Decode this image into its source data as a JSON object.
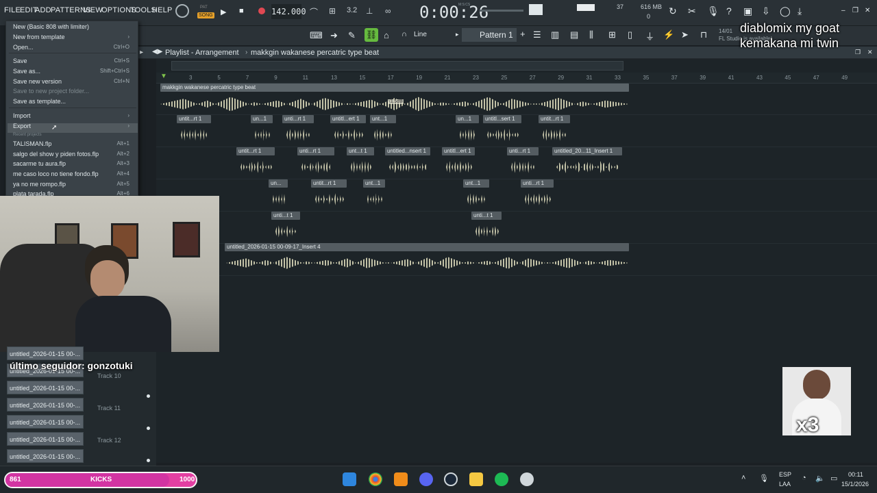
{
  "menubar": {
    "items": [
      "FILE",
      "EDIT",
      "ADD",
      "PATTERNS",
      "VIEW",
      "OPTIONS",
      "TOOLS",
      "HELP"
    ],
    "song_mode": "SONG",
    "pat_label": "PAT",
    "tempo": "142.000",
    "time": "0:00:26",
    "time_unit": "M:S:CS",
    "cpu": "37",
    "memory": "616 MB",
    "poly": "0"
  },
  "toolbar": {
    "snap": "Line",
    "pattern": "Pattern 1",
    "news": "14/01",
    "update_notice": "FL Studio is available!"
  },
  "playlist": {
    "title": "Playlist - Arrangement",
    "breadcrumb": "makkgin wakanese percatric type beat"
  },
  "ruler_ticks": [
    "3",
    "5",
    "7",
    "9",
    "11",
    "13",
    "15",
    "17",
    "19",
    "21",
    "23",
    "25",
    "27",
    "29",
    "31",
    "33",
    "35",
    "37",
    "39",
    "41",
    "43",
    "45",
    "47",
    "49"
  ],
  "clips": {
    "main": "makkgin wakanese percatric type beat",
    "gain": "-1.5dB",
    "row2": [
      "untit...rt 1",
      "un...1",
      "unti...rt 1",
      "untitl...ert 1",
      "unt...1",
      "un...1",
      "untitl...sert 1",
      "untit...rt 1"
    ],
    "row3": [
      "untit...rt 1",
      "unti...rt 1",
      "unt...t 1",
      "untitled...nsert 1",
      "untitl...ert 1",
      "unti...rt 1",
      "untitled_20...11_Insert 1"
    ],
    "row4": [
      "un...",
      "untit...rt 1",
      "unt...1",
      "unt...1",
      "unti...rt 1"
    ],
    "row5": [
      "unti...t 1",
      "unti...t 1"
    ],
    "insert4": "untitled_2026-01-15 00-09-17_Insert 4"
  },
  "file_menu": {
    "items": [
      {
        "label": "New (Basic 808 with limiter)",
        "shortcut": ""
      },
      {
        "label": "New from template",
        "shortcut": ""
      },
      {
        "label": "Open...",
        "shortcut": "Ctrl+O"
      },
      {
        "label": "Save",
        "shortcut": "Ctrl+S"
      },
      {
        "label": "Save as...",
        "shortcut": "Shift+Ctrl+S"
      },
      {
        "label": "Save new version",
        "shortcut": "Ctrl+N"
      },
      {
        "label": "Save to new project folder...",
        "shortcut": ""
      },
      {
        "label": "Save as template...",
        "shortcut": ""
      },
      {
        "label": "Import",
        "shortcut": ""
      },
      {
        "label": "Export",
        "shortcut": ""
      }
    ],
    "recent_header": "Recent projects",
    "recent": [
      {
        "label": "TALISMAN.flp",
        "shortcut": "Alt+1"
      },
      {
        "label": "salgo del show y piden fotos.flp",
        "shortcut": "Alt+2"
      },
      {
        "label": "sacarme tu aura.flp",
        "shortcut": "Alt+3"
      },
      {
        "label": "me caso loco no tiene fondo.flp",
        "shortcut": "Alt+4"
      },
      {
        "label": "ya no me rompo.flp",
        "shortcut": "Alt+5"
      },
      {
        "label": "plata tarada.flp",
        "shortcut": "Alt+6"
      }
    ]
  },
  "left_strips": [
    "untitled_2026-01-15 00-...",
    "untitled_2026-01-15 00-...",
    "untitled_2026-01-15 00-...",
    "untitled_2026-01-15 00-...",
    "untitled_2026-01-15 00-...",
    "untitled_2026-01-15 00-...",
    "untitled_2026-01-15 00-..."
  ],
  "track_labels": [
    "Track 10",
    "Track 11",
    "Track 12"
  ],
  "overlay": {
    "line1": "diablomix my goat",
    "line2": "kemakana mi twin",
    "follower": "último seguidor: gonzotuki",
    "meme_count": "x3"
  },
  "kicks_bar": {
    "left": "861",
    "label": "KICKS",
    "right": "1000",
    "progress": 0.861
  },
  "systray": {
    "lang1": "ESP",
    "lang2": "LAA",
    "clock": "00:11",
    "date": "15/1/2026"
  }
}
